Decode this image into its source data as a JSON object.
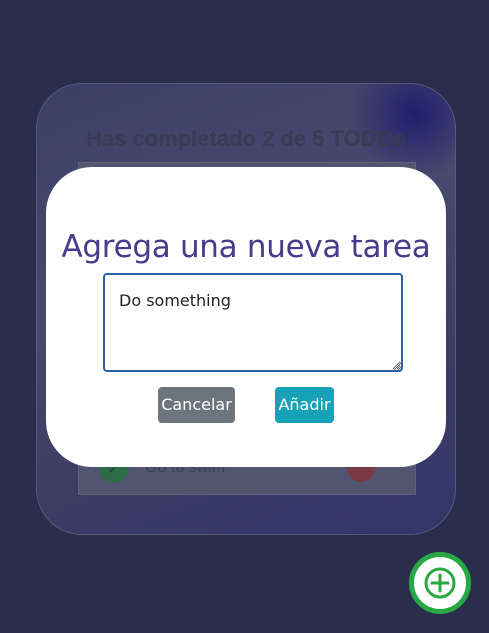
{
  "app": {
    "counter_title": "Has completado 2 de 5 TODOs"
  },
  "todos": {
    "visible_item_text": "Go to swim",
    "check_glyph": "✓"
  },
  "modal": {
    "title": "Agrega una nueva tarea",
    "textarea_value": "Do something",
    "cancel_label": "Cancelar",
    "add_label": "Añadir"
  },
  "fab": {
    "icon": "plus-icon"
  },
  "colors": {
    "background": "#2b2d4d",
    "modal_title": "#4a3a8c",
    "cancel_button": "#6c757d",
    "add_button": "#17a2b8",
    "fab_border": "#28a745"
  }
}
